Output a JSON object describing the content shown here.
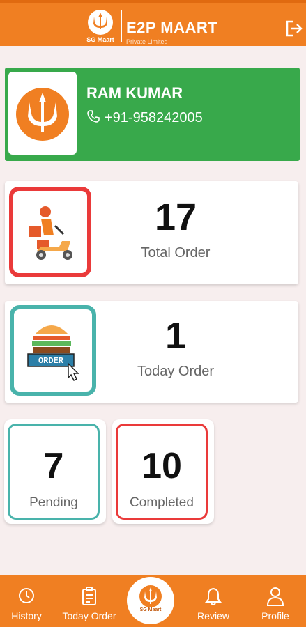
{
  "header": {
    "logo_text": "SG Maart",
    "title": "E2P MAART",
    "subtitle": "Private Limited",
    "logout_icon": "logout-icon"
  },
  "profile": {
    "name": "RAM KUMAR",
    "phone": "+91-958242005",
    "avatar_icon": "trident-logo-icon",
    "card_color": "#38a94b"
  },
  "stats": [
    {
      "value": "17",
      "label": "Total Order",
      "icon": "delivery-scooter-icon",
      "border_color": "#ea3a3a"
    },
    {
      "value": "1",
      "label": "Today Order",
      "icon": "burger-order-icon",
      "border_color": "#49b3ab"
    }
  ],
  "small_stats": [
    {
      "value": "7",
      "label": "Pending",
      "border_color": "#49b3ab"
    },
    {
      "value": "10",
      "label": "Completed",
      "border_color": "#ea3a3a"
    }
  ],
  "bottom_nav": {
    "items": [
      {
        "label": "History",
        "icon": "history-icon"
      },
      {
        "label": "Today Order",
        "icon": "clipboard-icon"
      },
      {
        "label": "Review",
        "icon": "bell-icon"
      },
      {
        "label": "Profile",
        "icon": "user-icon"
      }
    ],
    "center_label": "SG Maart"
  },
  "colors": {
    "accent": "#f07f22",
    "background": "#f7eeee"
  }
}
